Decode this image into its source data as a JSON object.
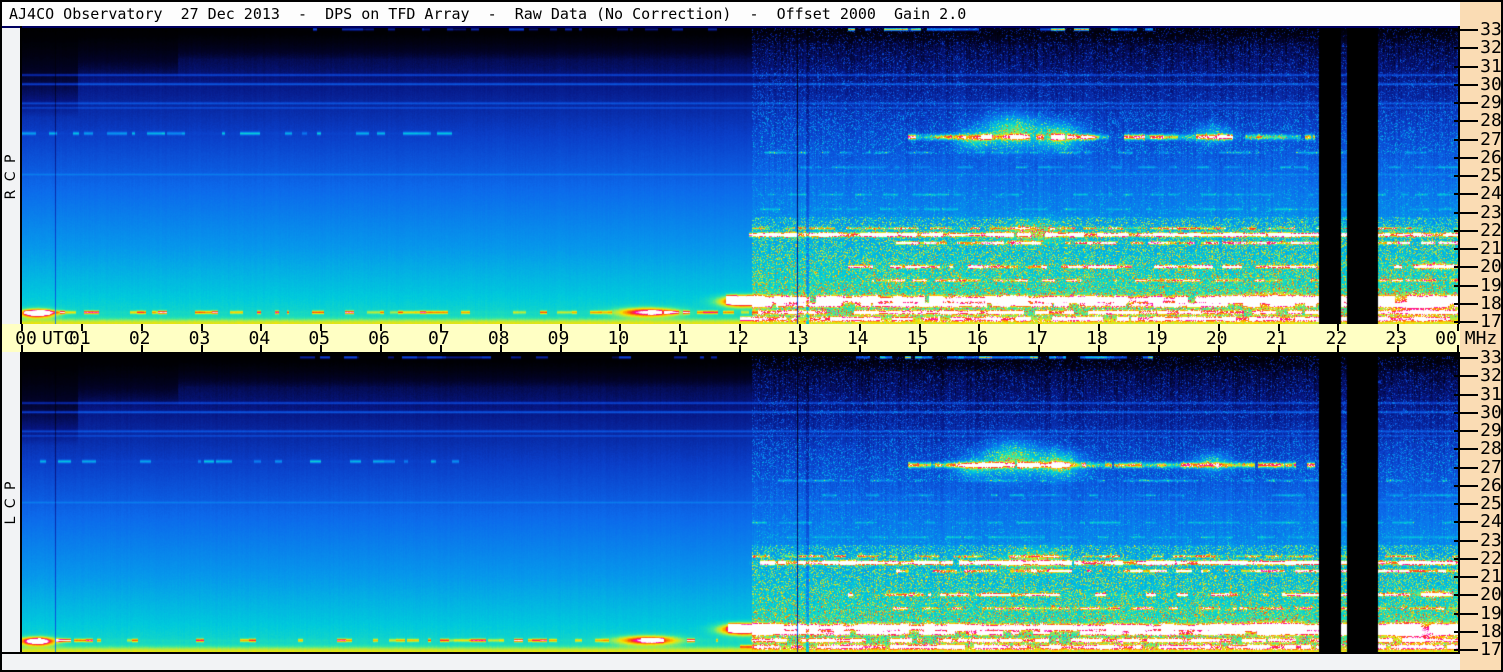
{
  "title_bar": {
    "text": "AJ4CO Observatory  27 Dec 2013  -  DPS on TFD Array  -  Raw Data (No Correction)  -  Offset 2000  Gain 2.0"
  },
  "panels": [
    {
      "id": "rcp",
      "label": "R C P"
    },
    {
      "id": "lcp",
      "label": "L C P"
    }
  ],
  "time_axis": {
    "unit_label": "UTC",
    "hours_start": 0,
    "hours_end": 24,
    "hour_labels": [
      "00",
      "01",
      "02",
      "03",
      "04",
      "05",
      "06",
      "07",
      "08",
      "09",
      "10",
      "11",
      "12",
      "13",
      "14",
      "15",
      "16",
      "17",
      "18",
      "19",
      "20",
      "21",
      "22",
      "23",
      "00"
    ]
  },
  "freq_axis": {
    "unit_label": "MHz",
    "min": 17,
    "max": 33,
    "ticks": [
      33,
      32,
      31,
      30,
      29,
      28,
      27,
      26,
      25,
      24,
      23,
      22,
      21,
      20,
      19,
      18,
      17
    ]
  },
  "colors": {
    "frame": "#000000",
    "title_bg": "#fdfdfd",
    "time_axis_bg": "#FFFFC4",
    "freq_strip_bg": "#FADCB4",
    "side_strip_bg": "#F2F3F5",
    "top_border_line": "#000060"
  },
  "chart_data": {
    "type": "heatmap",
    "title": "AJ4CO Observatory  27 Dec 2013  -  DPS on TFD Array  -  Raw Data (No Correction)  -  Offset 2000  Gain 2.0",
    "subtype": "dual-polarization radio spectrogram (RCP top, LCP bottom)",
    "xlabel": "UTC",
    "ylabel": "MHz",
    "x_range_hours": [
      0,
      24
    ],
    "y_range_mhz": [
      17,
      33
    ],
    "grid": false,
    "legend": "none",
    "visible_features": [
      "smooth galactic-background gradient: black at 33 MHz through blue to bright cyan at 17 MHz, quiet from 00-12 UTC",
      "darker black cap over top frequencies near 00:00-02:40 UTC",
      "faint steady RFI lines near 30.5, 30.0, 29.0, 28.7, 25.1 MHz across all 24 h",
      "cyan speckled line near 27.3 MHz from 00 to ~07 UTC",
      "strong ionospheric/shortwave activity after ~12.2 UTC: speckled green-yellow 17-23 MHz and 26-28.5 MHz",
      "intense yellow band near 27.2 MHz (~15-21.5 UTC) with orange/red patches 16-17.5 UTC",
      "red/magenta/white saturated streaks near 21.8, 20.0, 18.2, 17.9 MHz from ~12 UTC to 24 UTC",
      "yellow-green dashes near 17.5 MHz through the morning; orange blob ~10.5 UTC; magenta onset ~12 UTC",
      "two black data-dropout columns ~21:40-22:00 and ~22:09-22:39 UTC",
      "thin dark vertical lines at ~00:33 and ~12:57 UTC",
      "speckled bright top row (33 MHz) segments ~04:36-11:36 and ~13:48-18:54 UTC",
      "both RCP and LCP panels show essentially identical structure"
    ],
    "spectrogram_model": {
      "freq_top": 33.1,
      "freq_span": 16.16,
      "hours": 24,
      "base": [
        0.035,
        0.6
      ],
      "colormap": [
        [
          0.0,
          [
            0,
            0,
            0
          ]
        ],
        [
          0.06,
          [
            2,
            3,
            42
          ]
        ],
        [
          0.14,
          [
            6,
            22,
            130
          ]
        ],
        [
          0.25,
          [
            10,
            62,
            200
          ]
        ],
        [
          0.36,
          [
            12,
            106,
            235
          ]
        ],
        [
          0.48,
          [
            6,
            152,
            235
          ]
        ],
        [
          0.58,
          [
            0,
            202,
            220
          ]
        ],
        [
          0.66,
          [
            42,
            228,
            172
          ]
        ],
        [
          0.73,
          [
            152,
            236,
            88
          ]
        ],
        [
          0.8,
          [
            250,
            226,
            0
          ]
        ],
        [
          0.87,
          [
            255,
            138,
            0
          ]
        ],
        [
          0.92,
          [
            255,
            48,
            32
          ]
        ],
        [
          0.96,
          [
            255,
            0,
            182
          ]
        ],
        [
          1.0,
          [
            255,
            255,
            255
          ]
        ]
      ],
      "top_dark": [
        [
          0.93,
          0.3
        ],
        [
          2.6,
          0.17
        ],
        [
          12.2,
          0.105
        ],
        [
          25,
          0.055
        ]
      ],
      "activity": {
        "t_start": 12.2,
        "bands": [
          {
            "f0": 17.0,
            "f1": 22.8,
            "lift": 0.05,
            "density": 0.3,
            "amp": 0.3
          },
          {
            "f0": 22.8,
            "f1": 26.2,
            "lift": 0.02,
            "density": 0.12,
            "amp": 0.16
          },
          {
            "f0": 26.2,
            "f1": 28.6,
            "lift": 0.02,
            "density": 0.22,
            "amp": 0.26
          },
          {
            "f0": 28.6,
            "f1": 33.2,
            "lift": 0.01,
            "density": 0.15,
            "amp": 0.2
          }
        ]
      },
      "lines": [
        {
          "f": 33.05,
          "t": [
            4.6,
            11.6
          ],
          "amp": 0.2,
          "w": 0.07,
          "dash": 0.4
        },
        {
          "f": 33.05,
          "t": [
            13.8,
            18.9
          ],
          "amp": 0.55,
          "w": 0.07,
          "dash": 0.55
        },
        {
          "f": 30.55,
          "t": [
            0,
            24
          ],
          "amp": 0.14,
          "w": 0.06
        },
        {
          "f": 30.05,
          "t": [
            0,
            24
          ],
          "amp": 0.17,
          "w": 0.06
        },
        {
          "f": 29.0,
          "t": [
            0,
            24
          ],
          "amp": 0.12,
          "w": 0.06
        },
        {
          "f": 28.75,
          "t": [
            0,
            24
          ],
          "amp": 0.09,
          "w": 0.05
        },
        {
          "f": 27.35,
          "t": [
            0,
            7.3
          ],
          "amp": 0.24,
          "w": 0.08,
          "dash": 0.45
        },
        {
          "f": 27.15,
          "t": [
            14.8,
            21.6
          ],
          "amp": 0.5,
          "w": 0.15,
          "dash": 0.85
        },
        {
          "f": 26.3,
          "t": [
            12.2,
            24
          ],
          "amp": 0.17,
          "w": 0.06,
          "dash": 0.5
        },
        {
          "f": 25.5,
          "t": [
            13.0,
            24
          ],
          "amp": 0.14,
          "w": 0.06,
          "dash": 0.5
        },
        {
          "f": 25.1,
          "t": [
            0,
            24
          ],
          "amp": 0.08,
          "w": 0.05
        },
        {
          "f": 24.0,
          "t": [
            12.2,
            24
          ],
          "amp": 0.13,
          "w": 0.06,
          "dash": 0.55
        },
        {
          "f": 23.2,
          "t": [
            12.2,
            24
          ],
          "amp": 0.11,
          "w": 0.06,
          "dash": 0.55
        },
        {
          "f": 22.15,
          "t": [
            12.2,
            24
          ],
          "amp": 0.3,
          "w": 0.07,
          "dash": 0.7
        },
        {
          "f": 21.8,
          "t": [
            12.15,
            24
          ],
          "amp": 0.75,
          "w": 0.11,
          "dash": 0.93
        },
        {
          "f": 21.35,
          "t": [
            14.6,
            24
          ],
          "amp": 0.45,
          "w": 0.08,
          "dash": 0.75
        },
        {
          "f": 20.05,
          "t": [
            13.8,
            24
          ],
          "amp": 0.55,
          "w": 0.08,
          "dash": 0.72
        },
        {
          "f": 19.3,
          "t": [
            14.2,
            24
          ],
          "amp": 0.3,
          "w": 0.07,
          "dash": 0.6
        },
        {
          "f": 18.25,
          "t": [
            11.75,
            24
          ],
          "amp": 0.78,
          "w": 0.17,
          "dash": 0.95
        },
        {
          "f": 17.95,
          "t": [
            12.2,
            24
          ],
          "amp": 0.5,
          "w": 0.1,
          "dash": 0.85
        },
        {
          "f": 17.55,
          "t": [
            0,
            12.2
          ],
          "amp": 0.26,
          "w": 0.09,
          "dash": 0.45
        },
        {
          "f": 17.55,
          "t": [
            12.2,
            24
          ],
          "amp": 0.45,
          "w": 0.1,
          "dash": 0.85
        },
        {
          "f": 17.2,
          "t": [
            12.0,
            24
          ],
          "amp": 0.4,
          "w": 0.1,
          "dash": 0.8
        },
        {
          "f": 16.95,
          "t": [
            0,
            24
          ],
          "amp": 0.15,
          "w": 0.25
        }
      ],
      "blobs": [
        {
          "t": 0.25,
          "f": 17.5,
          "st": 0.28,
          "sf": 0.22,
          "amp": 0.55
        },
        {
          "t": 10.45,
          "f": 17.55,
          "st": 0.5,
          "sf": 0.25,
          "amp": 0.4
        },
        {
          "t": 12.05,
          "f": 18.15,
          "st": 0.38,
          "sf": 0.3,
          "amp": 0.55
        },
        {
          "t": 15.9,
          "f": 27.0,
          "st": 0.28,
          "sf": 0.5,
          "amp": 0.3
        },
        {
          "t": 16.55,
          "f": 27.5,
          "st": 0.5,
          "sf": 0.9,
          "amp": 0.42
        },
        {
          "t": 17.35,
          "f": 27.2,
          "st": 0.35,
          "sf": 0.7,
          "amp": 0.4
        },
        {
          "t": 16.9,
          "f": 21.9,
          "st": 0.5,
          "sf": 0.6,
          "amp": 0.22
        },
        {
          "t": 19.9,
          "f": 27.3,
          "st": 0.3,
          "sf": 0.5,
          "amp": 0.25
        },
        {
          "t": 20.9,
          "f": 18.2,
          "st": 0.45,
          "sf": 0.4,
          "amp": 0.28
        },
        {
          "t": 23.35,
          "f": 18.0,
          "st": 0.5,
          "sf": 0.5,
          "amp": 0.35
        },
        {
          "t": 23.6,
          "f": 20.1,
          "st": 0.3,
          "sf": 0.2,
          "amp": 0.3
        }
      ],
      "vlines": [
        {
          "t": 0.55,
          "mul": 0.55,
          "w": 1
        },
        {
          "t": 12.95,
          "mul": 0.25,
          "w": 1
        },
        {
          "t": 13.1,
          "mul": 0.75,
          "w": 3
        }
      ],
      "blackouts": [
        {
          "t0": 21.67,
          "t1": 22.02
        },
        {
          "t0": 22.15,
          "t1": 22.65
        }
      ],
      "seeds": {
        "rcp": 20131227,
        "lcp": 19571227
      }
    }
  }
}
